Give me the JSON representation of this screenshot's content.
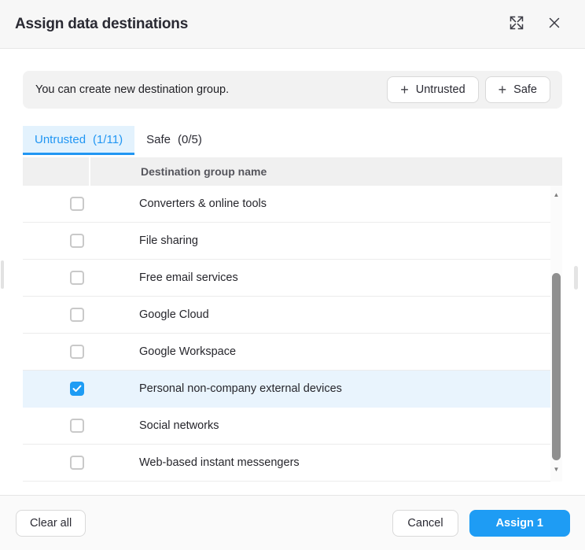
{
  "dialog": {
    "title": "Assign data destinations"
  },
  "icons": {
    "expand": "⤢",
    "close": "✕",
    "plus": "+",
    "check": "✓",
    "arrow_up": "▲",
    "arrow_down": "▼"
  },
  "banner": {
    "message": "You can create new destination group.",
    "buttons": [
      {
        "label": "Untrusted"
      },
      {
        "label": "Safe"
      }
    ]
  },
  "tabs": [
    {
      "label": "Untrusted",
      "count": "(1/11)",
      "active": true
    },
    {
      "label": "Safe",
      "count": "(0/5)",
      "active": false
    }
  ],
  "table": {
    "column_header": "Destination group name",
    "rows": [
      {
        "name": "Converters & online tools",
        "checked": false
      },
      {
        "name": "File sharing",
        "checked": false
      },
      {
        "name": "Free email services",
        "checked": false
      },
      {
        "name": "Google Cloud",
        "checked": false
      },
      {
        "name": "Google Workspace",
        "checked": false
      },
      {
        "name": "Personal non-company external devices",
        "checked": true
      },
      {
        "name": "Social networks",
        "checked": false
      },
      {
        "name": "Web-based instant messengers",
        "checked": false
      }
    ]
  },
  "footer": {
    "clear_all_label": "Clear all",
    "cancel_label": "Cancel",
    "assign_label": "Assign 1"
  },
  "colors": {
    "accent_blue": "#1e9cf4",
    "active_tab_text": "#2196f3",
    "active_tab_bg": "#e3f2fd",
    "selected_row_bg": "#e9f4fd",
    "header_bg": "#f7f7f7",
    "banner_bg": "#f2f2f2",
    "table_header_bg": "#f0f0f0"
  }
}
